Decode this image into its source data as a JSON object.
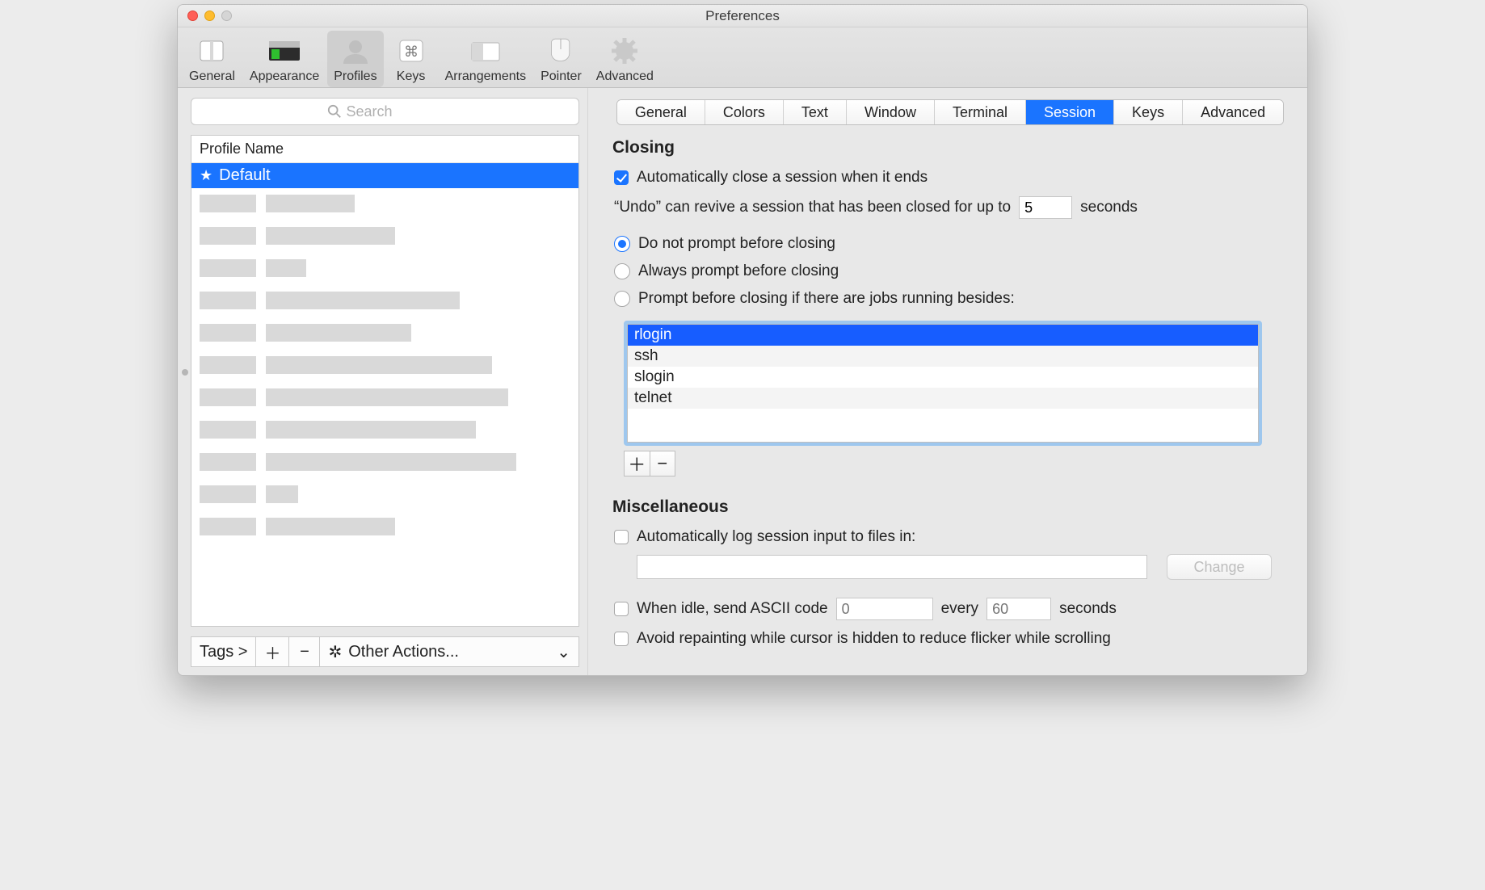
{
  "window": {
    "title": "Preferences"
  },
  "toolbar": {
    "items": [
      {
        "label": "General"
      },
      {
        "label": "Appearance"
      },
      {
        "label": "Profiles"
      },
      {
        "label": "Keys"
      },
      {
        "label": "Arrangements"
      },
      {
        "label": "Pointer"
      },
      {
        "label": "Advanced"
      }
    ]
  },
  "left": {
    "search_placeholder": "Search",
    "column_header": "Profile Name",
    "selected_profile": "Default",
    "tags_label": "Tags >",
    "other_actions_label": "Other Actions..."
  },
  "tabs": {
    "items": [
      "General",
      "Colors",
      "Text",
      "Window",
      "Terminal",
      "Session",
      "Keys",
      "Advanced"
    ],
    "selected": "Session"
  },
  "closing": {
    "title": "Closing",
    "auto_close_label": "Automatically close a session when it ends",
    "undo_prefix": "“Undo” can revive a session that has been closed for up to",
    "undo_seconds_value": "5",
    "undo_suffix": "seconds",
    "prompt_none": "Do not prompt before closing",
    "prompt_always": "Always prompt before closing",
    "prompt_jobs": "Prompt before closing if there are jobs running besides:",
    "jobs": [
      "rlogin",
      "ssh",
      "slogin",
      "telnet"
    ]
  },
  "misc": {
    "title": "Miscellaneous",
    "log_label": "Automatically log session input to files in:",
    "change_label": "Change",
    "idle_prefix": "When idle, send ASCII code",
    "idle_code_placeholder": "0",
    "idle_every": "every",
    "idle_interval_placeholder": "60",
    "idle_suffix": "seconds",
    "avoid_repaint": "Avoid repainting while cursor is hidden to reduce flicker while scrolling"
  }
}
